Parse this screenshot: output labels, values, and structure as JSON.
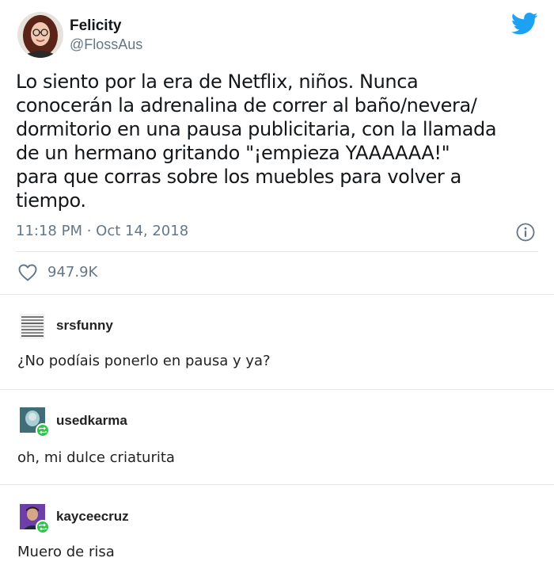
{
  "tweet": {
    "display_name": "Felicity",
    "handle": "@FlossAus",
    "text": "Lo siento por la era de Netflix, niños. Nunca\nconocerán la adrenalina de correr al baño/nevera/\ndormitorio en una pausa publicitaria, con la llamada\nde un hermano gritando \"¡empieza YAAAAAA!\"\npara que corras sobre los muebles para volver a\ntiempo.",
    "timestamp": "11:18 PM · Oct 14, 2018",
    "likes": "947.9K",
    "brand_color": "#1da1f2"
  },
  "replies": [
    {
      "username": "srsfunny",
      "text": "¿No podíais ponerlo en pausa y ya?",
      "reblog": false
    },
    {
      "username": "usedkarma",
      "text": "oh, mi dulce criaturita",
      "reblog": true
    },
    {
      "username": "kayceecruz",
      "text": "Muero de risa",
      "reblog": true
    }
  ],
  "colors": {
    "reblog_green": "#33c34d",
    "muted_text": "#657786",
    "divider": "#e1e8ed"
  }
}
